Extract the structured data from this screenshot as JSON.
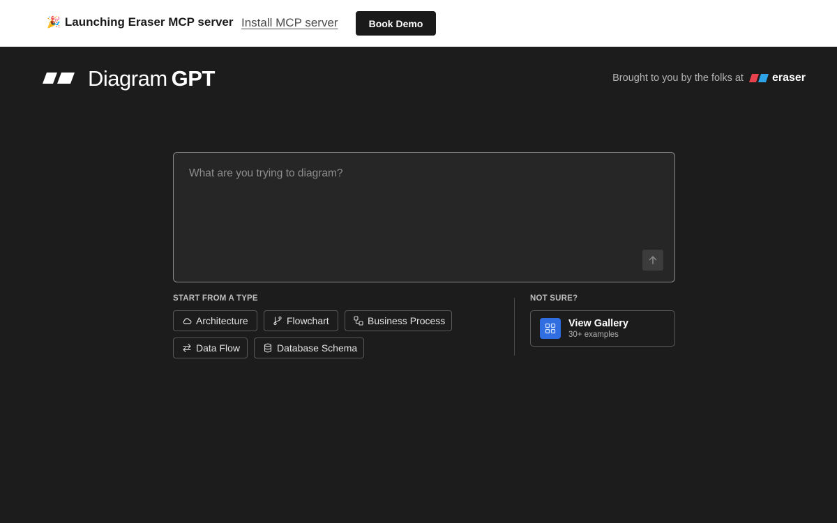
{
  "announcement": {
    "emoji": "🎉",
    "headline": "Launching Eraser MCP server",
    "link_label": "Install MCP server",
    "button_label": "Book Demo"
  },
  "header": {
    "brand_light": "Diagram",
    "brand_bold": "GPT",
    "byline": "Brought to you by the folks at",
    "partner_name": "eraser"
  },
  "prompt": {
    "placeholder": "What are you trying to diagram?",
    "value": ""
  },
  "types": {
    "label": "START FROM A TYPE",
    "items": [
      {
        "label": "Architecture",
        "icon": "cloud-icon"
      },
      {
        "label": "Flowchart",
        "icon": "git-branch-icon"
      },
      {
        "label": "Business Process",
        "icon": "workflow-icon"
      },
      {
        "label": "Data Flow",
        "icon": "arrows-left-right-icon"
      },
      {
        "label": "Database Schema",
        "icon": "database-icon"
      }
    ]
  },
  "gallery": {
    "label": "NOT SURE?",
    "title": "View Gallery",
    "subtitle": "30+ examples",
    "icon": "grid-icon"
  },
  "colors": {
    "background": "#1c1c1c",
    "accent": "#2f6de0",
    "eraser_red": "#e8424f",
    "eraser_blue": "#2fa3e8"
  }
}
